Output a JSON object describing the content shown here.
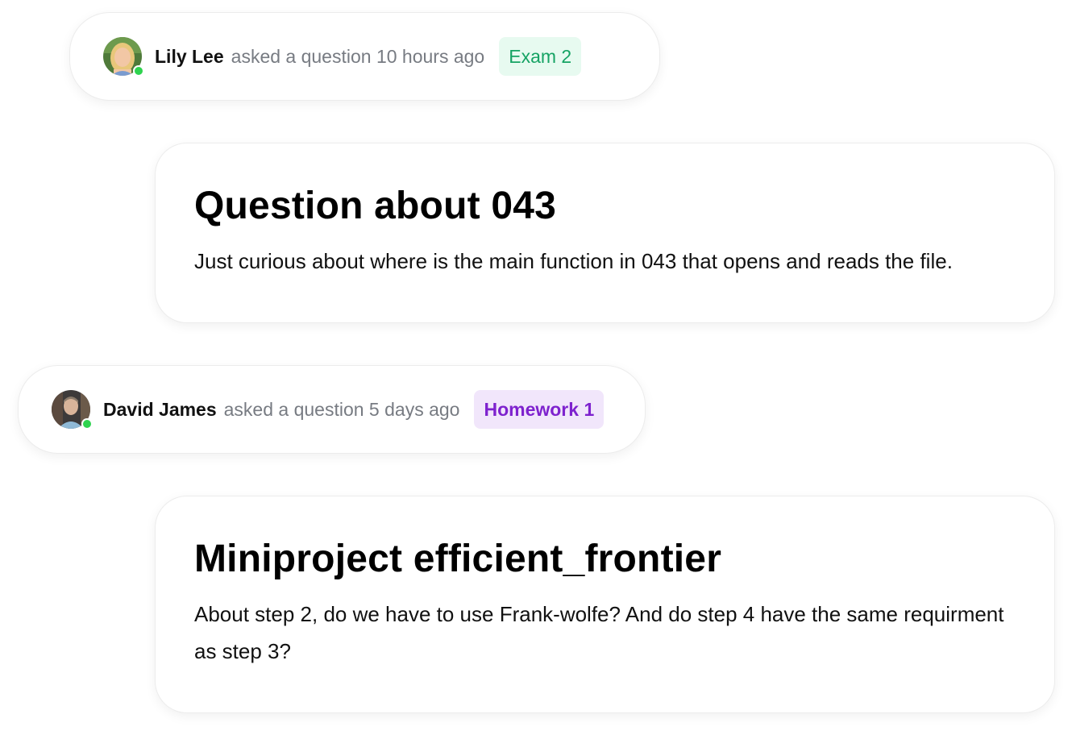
{
  "posts": [
    {
      "author": "Lily Lee",
      "action": "asked a question 10 hours ago",
      "tag": "Exam 2",
      "tag_color": "#16a364",
      "status": "online",
      "title": "Question about 043",
      "body": "Just curious about where is the main function in 043 that opens and reads the file."
    },
    {
      "author": "David James",
      "action": "asked a question 5 days ago",
      "tag": "Homework 1",
      "tag_color": "#7e22ce",
      "status": "online",
      "title": "Miniproject efficient_frontier",
      "body": "About step 2, do we have to use Frank-wolfe? And do step 4 have the same requirment as step 3?"
    }
  ],
  "colors": {
    "online_dot": "#2fd34f",
    "meta_text": "#777b82"
  }
}
